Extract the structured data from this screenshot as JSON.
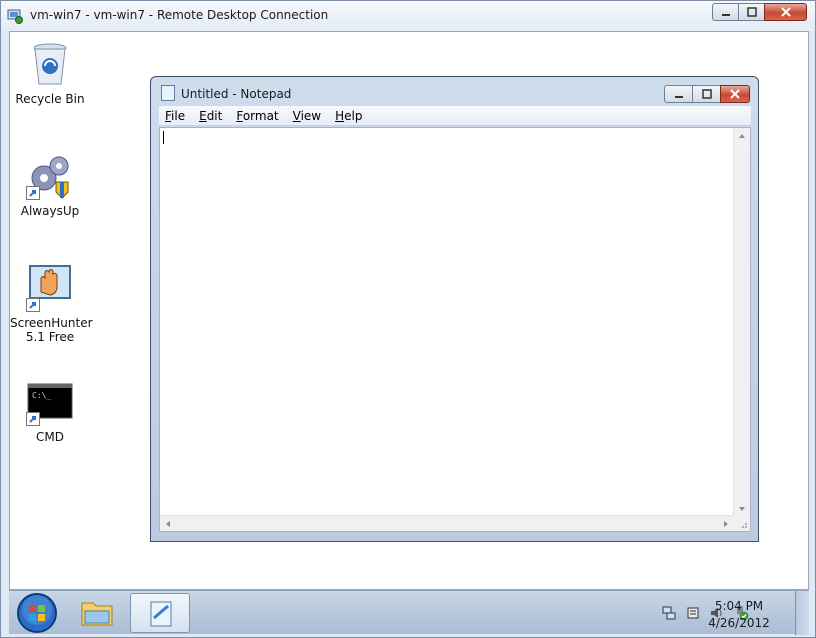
{
  "rdp": {
    "title": "vm-win7 - vm-win7 - Remote Desktop Connection",
    "app_icon": "remote-desktop-icon"
  },
  "desktop": {
    "icons": [
      {
        "label": "Recycle Bin",
        "icon": "recycle-bin-icon"
      },
      {
        "label": "AlwaysUp",
        "icon": "alwaysup-gears-icon"
      },
      {
        "label": "ScreenHunter\n5.1 Free",
        "icon": "screenhunter-hand-icon"
      },
      {
        "label": "CMD",
        "icon": "cmd-console-icon"
      }
    ]
  },
  "notepad": {
    "title": "Untitled - Notepad",
    "menu": [
      {
        "label": "File",
        "accel": "F",
        "rest": "ile"
      },
      {
        "label": "Edit",
        "accel": "E",
        "rest": "dit"
      },
      {
        "label": "Format",
        "accel": "F",
        "rest": "ormat"
      },
      {
        "label": "View",
        "accel": "V",
        "rest": "iew"
      },
      {
        "label": "Help",
        "accel": "H",
        "rest": "elp"
      }
    ],
    "content": ""
  },
  "taskbar": {
    "clock_time": "5:04 PM",
    "clock_date": "4/26/2012",
    "tray_icons": [
      "network-icon",
      "action-center-icon",
      "volume-icon",
      "safely-remove-icon"
    ]
  },
  "colors": {
    "close_red": "#c84a34",
    "accent_blue": "#3a7bd5"
  }
}
